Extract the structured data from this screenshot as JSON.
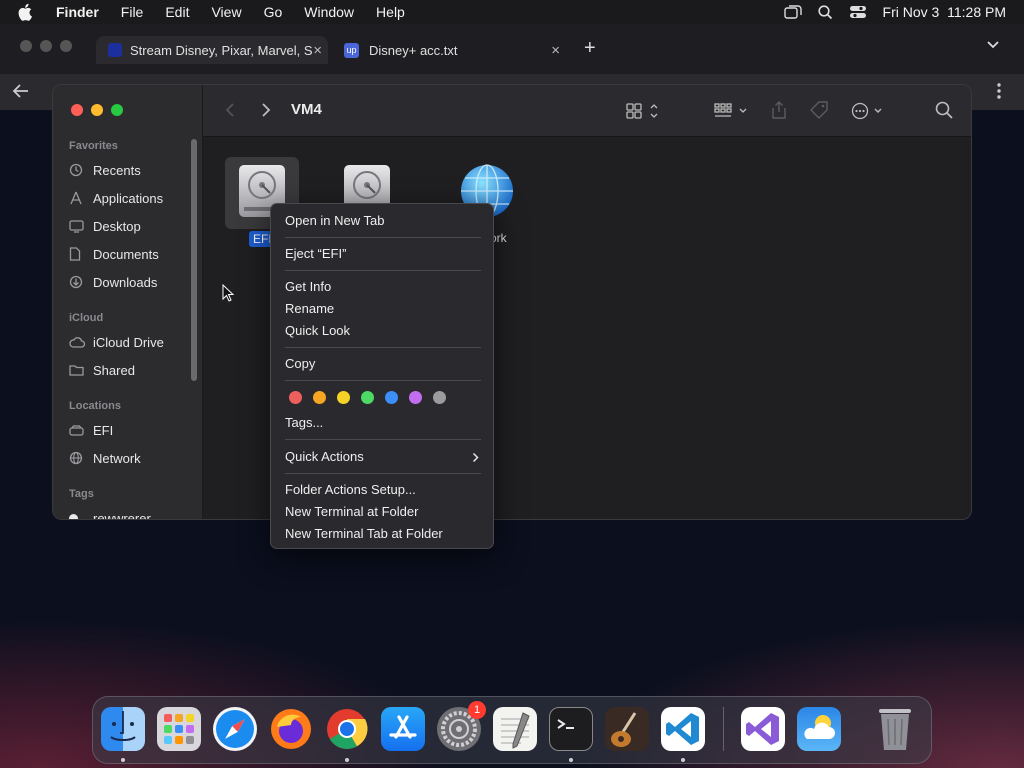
{
  "menubar": {
    "finder": "Finder",
    "file": "File",
    "edit": "Edit",
    "view": "View",
    "go": "Go",
    "window": "Window",
    "help": "Help",
    "clock": "Fri Nov 3  11:28 PM"
  },
  "browser": {
    "tabs": [
      {
        "title": "Stream Disney, Pixar, Marvel, S"
      },
      {
        "title": "Disney+ acc.txt"
      }
    ],
    "new_tab": "+",
    "chevron": "⌄"
  },
  "finder": {
    "title": "VM4",
    "sidebar": {
      "favorites_header": "Favorites",
      "favorites": [
        {
          "label": "Recents",
          "icon": "clock-icon"
        },
        {
          "label": "Applications",
          "icon": "applications-icon"
        },
        {
          "label": "Desktop",
          "icon": "desktop-icon"
        },
        {
          "label": "Documents",
          "icon": "document-icon"
        },
        {
          "label": "Downloads",
          "icon": "download-icon"
        }
      ],
      "icloud_header": "iCloud",
      "icloud": [
        {
          "label": "iCloud Drive",
          "icon": "cloud-icon"
        },
        {
          "label": "Shared",
          "icon": "shared-folder-icon"
        }
      ],
      "locations_header": "Locations",
      "locations": [
        {
          "label": "EFI",
          "icon": "disk-icon"
        },
        {
          "label": "Network",
          "icon": "globe-icon"
        }
      ],
      "tags_header": "Tags",
      "tags": [
        {
          "label": "rewwrerer"
        }
      ]
    },
    "files": [
      {
        "name": "EFI",
        "visible_label": "EFI",
        "selected": true
      },
      {
        "name": "disk",
        "visible_label": ""
      },
      {
        "name": "Network",
        "visible_label": "ork"
      }
    ]
  },
  "context_menu": {
    "items": {
      "open_new_tab": "Open in New Tab",
      "eject": "Eject “EFI”",
      "get_info": "Get Info",
      "rename": "Rename",
      "quick_look": "Quick Look",
      "copy": "Copy",
      "tags": "Tags...",
      "quick_actions": "Quick Actions",
      "folder_actions": "Folder Actions Setup...",
      "new_terminal": "New Terminal at Folder",
      "new_terminal_tab": "New Terminal Tab at Folder"
    },
    "tag_colors": [
      "#ec5f5d",
      "#f5a623",
      "#f5d327",
      "#4cd964",
      "#3b8ff6",
      "#c36ef0",
      "#9b9b9e"
    ]
  },
  "dock": {
    "apps": [
      "Finder",
      "Launchpad",
      "Safari",
      "Firefox",
      "Chrome",
      "App Store",
      "System Settings",
      "TextEdit",
      "Terminal",
      "Instruments",
      "Visual Studio Code",
      "Visual Studio",
      "Weather",
      "Trash"
    ],
    "badges": {
      "system_settings": "1"
    }
  }
}
